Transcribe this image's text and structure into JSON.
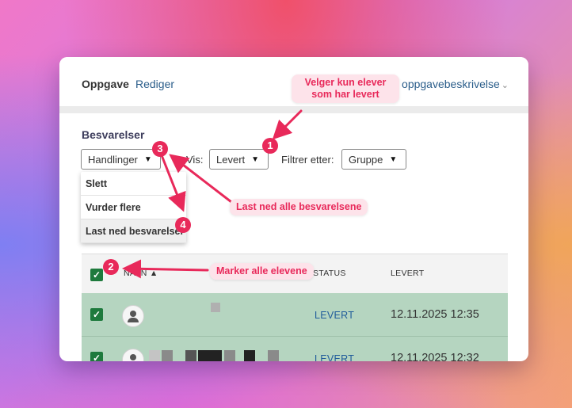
{
  "header": {
    "assignment_label": "Oppgave",
    "edit_link": "Rediger",
    "show_description": "is oppgavebeskrivelse",
    "chevron": "⌄"
  },
  "submissions": {
    "title": "Besvarelser",
    "actions_select": "Handlinger",
    "show_label": "Vis:",
    "show_select": "Levert",
    "filter_label": "Filtrer etter:",
    "filter_select": "Gruppe"
  },
  "actions_menu": {
    "items": [
      "Slett",
      "Vurder flere",
      "Last ned besvarelser"
    ]
  },
  "table": {
    "columns": [
      "NAVN",
      "STATUS",
      "LEVERT"
    ],
    "sort_indicator": "▲",
    "rows": [
      {
        "status": "LEVERT",
        "delivered": "12.11.2025 12:35"
      },
      {
        "status": "LEVERT",
        "delivered": "12.11.2025 12:32"
      }
    ]
  },
  "annotations": {
    "callout_1": [
      "Velger kun elever",
      "som har levert"
    ],
    "callout_3": "Last ned alle besvarelsene",
    "callout_2": "Marker alle elevene",
    "badges": [
      "1",
      "2",
      "3",
      "4"
    ]
  },
  "colors": {
    "accent": "#e8295a",
    "callout_bg": "#fde3ea",
    "link": "#2a5d8a",
    "row_selected": "#b5d5c0",
    "checkbox": "#1e7a3d"
  },
  "icons": {
    "caret": "▼",
    "check": "✓"
  }
}
